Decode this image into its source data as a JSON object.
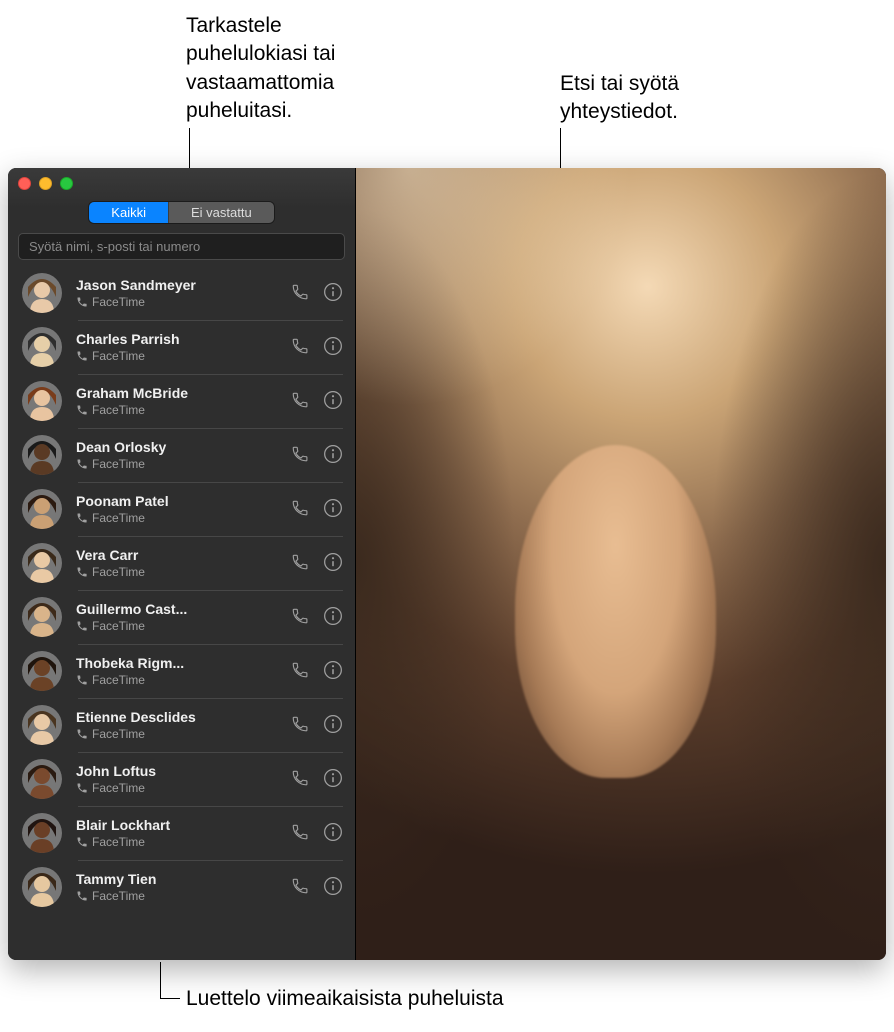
{
  "callouts": {
    "tabs": "Tarkastele\npuhelulokiasi tai\nvastaamattomia\npuheluitasi.",
    "search": "Etsi tai syötä\nyhteystiedot.",
    "list": "Luettelo viimeaikaisista puheluista"
  },
  "tabs": {
    "all": "Kaikki",
    "missed": "Ei vastattu"
  },
  "search": {
    "placeholder": "Syötä nimi, s-posti tai numero"
  },
  "subtype_label": "FaceTime",
  "contacts": [
    {
      "name": "Jason Sandmeyer",
      "sub": "FaceTime",
      "skin": "#e8c9a8",
      "hair": "#6b4a2b"
    },
    {
      "name": "Charles Parrish",
      "sub": "FaceTime",
      "skin": "#e6cfa8",
      "hair": "#2e2e2e"
    },
    {
      "name": "Graham McBride",
      "sub": "FaceTime",
      "skin": "#e8c4a0",
      "hair": "#7a3c1a"
    },
    {
      "name": "Dean Orlosky",
      "sub": "FaceTime",
      "skin": "#5a3a24",
      "hair": "#1a1a1a"
    },
    {
      "name": "Poonam Patel",
      "sub": "FaceTime",
      "skin": "#caa074",
      "hair": "#2b1a10"
    },
    {
      "name": "Vera Carr",
      "sub": "FaceTime",
      "skin": "#e9c9a4",
      "hair": "#3a2a1a"
    },
    {
      "name": "Guillermo Cast...",
      "sub": "FaceTime",
      "skin": "#d9b48a",
      "hair": "#3d2a1a"
    },
    {
      "name": "Thobeka Rigm...",
      "sub": "FaceTime",
      "skin": "#6b4226",
      "hair": "#1f140c"
    },
    {
      "name": "Etienne Desclides",
      "sub": "FaceTime",
      "skin": "#e8c9a6",
      "hair": "#4a3520"
    },
    {
      "name": "John Loftus",
      "sub": "FaceTime",
      "skin": "#7a4a2e",
      "hair": "#2a1a10"
    },
    {
      "name": "Blair Lockhart",
      "sub": "FaceTime",
      "skin": "#6a3f26",
      "hair": "#201410"
    },
    {
      "name": "Tammy Tien",
      "sub": "FaceTime",
      "skin": "#e6c8a0",
      "hair": "#3a2818"
    }
  ]
}
